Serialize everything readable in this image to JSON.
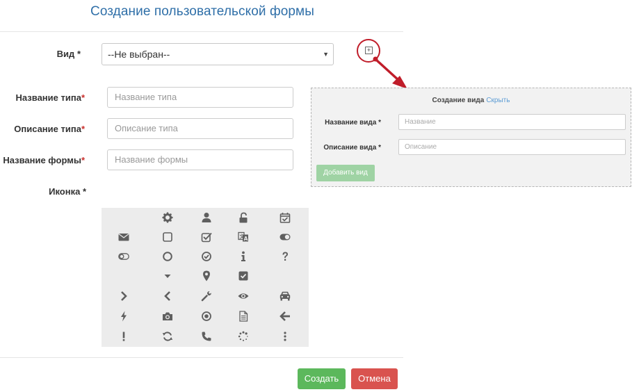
{
  "page": {
    "title": "Создание пользовательской формы"
  },
  "form": {
    "vid_label": "Вид",
    "vid_req": "*",
    "vid_value": "--Не выбран--",
    "type_name_label": "Название типа",
    "type_name_placeholder": "Название типа",
    "type_desc_label": "Описание типа",
    "type_desc_placeholder": "Описание типа",
    "form_name_label": "Название формы",
    "form_name_placeholder": "Название формы",
    "icon_label": "Иконка",
    "req_mark": "*"
  },
  "panel": {
    "title": "Создание вида",
    "hide_link": "Скрыть",
    "name_label": "Название вида *",
    "name_placeholder": "Название",
    "desc_label": "Описание вида *",
    "desc_placeholder": "Описание",
    "add_button": "Добавить вид"
  },
  "icons": [
    [
      "",
      "gear",
      "user",
      "unlock",
      "calendar-check"
    ],
    [
      "envelope",
      "checkbox-empty",
      "checkbox-checked",
      "translate",
      "toggle-on"
    ],
    [
      "toggle-off",
      "circle-empty",
      "check-circle",
      "info",
      "question"
    ],
    [
      "",
      "caret-down",
      "map-marker",
      "check-square",
      ""
    ],
    [
      "chevron-right",
      "chevron-left",
      "wrench",
      "eye",
      "car"
    ],
    [
      "bolt",
      "camera",
      "dot-circle",
      "file-text",
      "arrow-left"
    ],
    [
      "exclamation",
      "refresh",
      "phone",
      "spinner",
      "ellipsis-vertical"
    ]
  ],
  "footer": {
    "create": "Создать",
    "cancel": "Отмена"
  },
  "colors": {
    "title": "#2f6fa8",
    "create_button": "#5cb85c",
    "cancel_button": "#d9534f",
    "panel_button": "#9fd3a4",
    "callout": "#c01d2a"
  }
}
